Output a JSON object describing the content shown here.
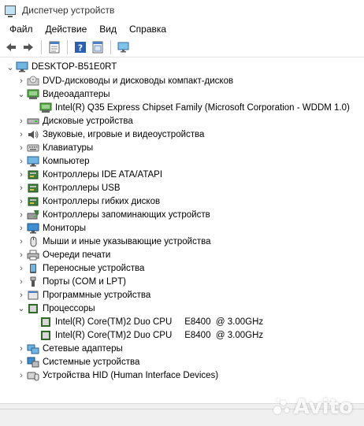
{
  "window": {
    "title": "Диспетчер устройств"
  },
  "menu": {
    "items": [
      "Файл",
      "Действие",
      "Вид",
      "Справка"
    ]
  },
  "toolbar": {
    "icons": [
      "back-arrow-icon",
      "forward-arrow-icon",
      "properties-icon",
      "help-icon",
      "update-driver-icon",
      "monitor-scan-icon"
    ]
  },
  "tree": {
    "root": "DESKTOP-B51E0RT",
    "items": [
      {
        "label": "DVD-дисководы и дисководы компакт-дисков",
        "icon": "dvd-drive-icon",
        "expanded": false
      },
      {
        "label": "Видеоадаптеры",
        "icon": "display-adapter-icon",
        "expanded": true
      },
      {
        "label": "Intel(R) Q35 Express Chipset Family (Microsoft Corporation - WDDM 1.0)",
        "icon": "display-adapter-icon",
        "child": true
      },
      {
        "label": "Дисковые устройства",
        "icon": "disk-drive-icon",
        "expanded": false
      },
      {
        "label": "Звуковые, игровые и видеоустройства",
        "icon": "sound-icon",
        "expanded": false
      },
      {
        "label": "Клавиатуры",
        "icon": "keyboard-icon",
        "expanded": false
      },
      {
        "label": "Компьютер",
        "icon": "computer-icon",
        "expanded": false
      },
      {
        "label": "Контроллеры IDE ATA/ATAPI",
        "icon": "ide-controller-icon",
        "expanded": false
      },
      {
        "label": "Контроллеры USB",
        "icon": "usb-controller-icon",
        "expanded": false
      },
      {
        "label": "Контроллеры гибких дисков",
        "icon": "floppy-controller-icon",
        "expanded": false
      },
      {
        "label": "Контроллеры запоминающих устройств",
        "icon": "storage-controller-icon",
        "expanded": false
      },
      {
        "label": "Мониторы",
        "icon": "monitor-icon",
        "expanded": false
      },
      {
        "label": "Мыши и иные указывающие устройства",
        "icon": "mouse-icon",
        "expanded": false
      },
      {
        "label": "Очереди печати",
        "icon": "printer-icon",
        "expanded": false
      },
      {
        "label": "Переносные устройства",
        "icon": "portable-device-icon",
        "expanded": false
      },
      {
        "label": "Порты (COM и LPT)",
        "icon": "port-icon",
        "expanded": false
      },
      {
        "label": "Программные устройства",
        "icon": "software-device-icon",
        "expanded": false
      },
      {
        "label": "Процессоры",
        "icon": "processor-icon",
        "expanded": true
      },
      {
        "label": "Intel(R) Core(TM)2 Duo CPU     E8400  @ 3.00GHz",
        "icon": "processor-icon",
        "child": true
      },
      {
        "label": "Intel(R) Core(TM)2 Duo CPU     E8400  @ 3.00GHz",
        "icon": "processor-icon",
        "child": true
      },
      {
        "label": "Сетевые адаптеры",
        "icon": "network-adapter-icon",
        "expanded": false
      },
      {
        "label": "Системные устройства",
        "icon": "system-device-icon",
        "expanded": false
      },
      {
        "label": "Устройства HID (Human Interface Devices)",
        "icon": "hid-icon",
        "expanded": false
      }
    ]
  },
  "watermark": {
    "text": "Avito"
  }
}
